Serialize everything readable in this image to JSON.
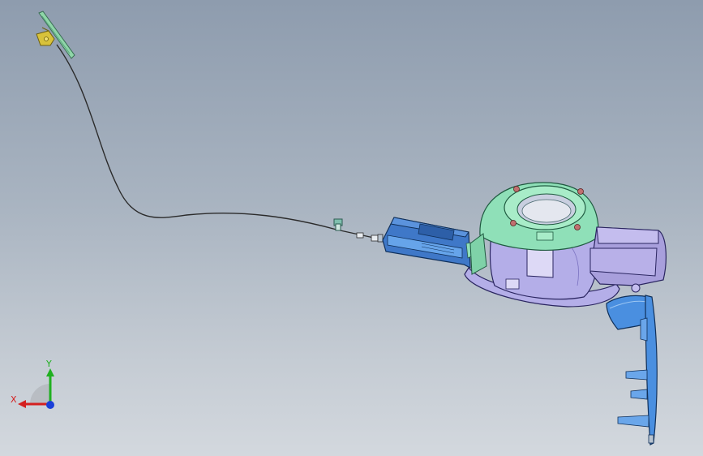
{
  "viewport": {
    "background_top": "#8e9cae",
    "background_bottom": "#d3d8de"
  },
  "model": {
    "parts": [
      {
        "name": "release-handle-lever",
        "color": "#8fd6a8"
      },
      {
        "name": "handle-clip",
        "color": "#d8c23a"
      },
      {
        "name": "release-cable",
        "color": "#2b2b2b"
      },
      {
        "name": "cable-clip",
        "color": "#7fbfae"
      },
      {
        "name": "actuator-housing",
        "color": "#3f78c8"
      },
      {
        "name": "filler-housing-ring",
        "color": "#8fe0b8"
      },
      {
        "name": "filler-bucket",
        "color": "#b4aee8"
      },
      {
        "name": "filler-bracket",
        "color": "#a89fdc"
      },
      {
        "name": "fuel-door",
        "color": "#4a8fe0"
      }
    ]
  },
  "triad": {
    "x_label": "X",
    "y_label": "Y",
    "x_color": "#d42020",
    "y_color": "#20b020",
    "z_color": "#1a3fd8"
  }
}
